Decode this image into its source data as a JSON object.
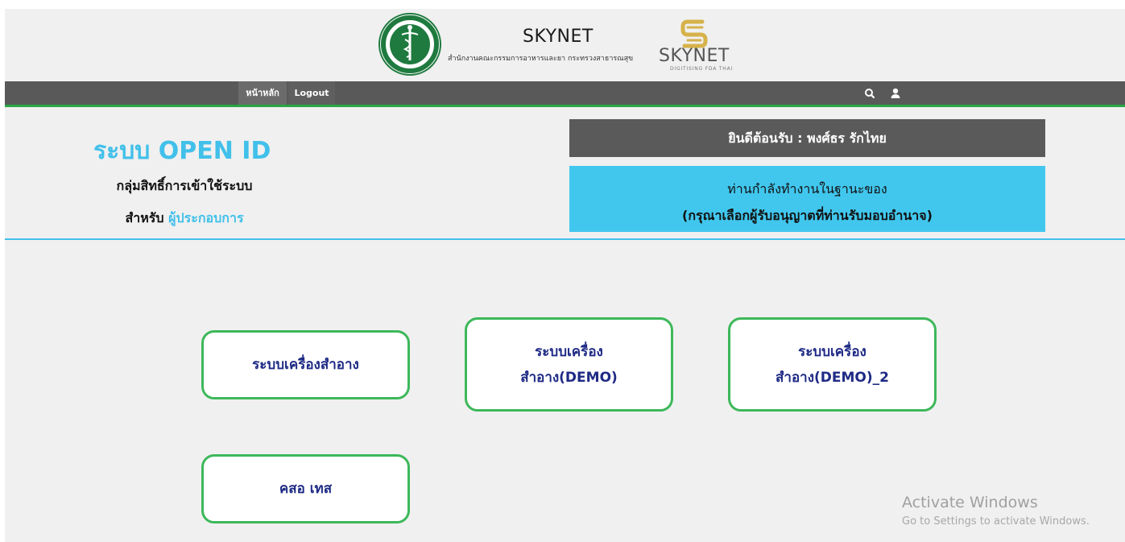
{
  "header": {
    "title": "SKYNET",
    "subtitle": "สำนักงานคณะกรรมการอาหารและยา กระทรวงสาธารณสุข",
    "brand": "SKYNET",
    "brand_tagline": "DIGITISING FDA THAI",
    "brand_color": "#d6b24a",
    "emblem_color": "#1f7a3f"
  },
  "nav": {
    "items": [
      "หน้าหลัก",
      "Logout"
    ],
    "icons": [
      "search-icon",
      "user-icon"
    ]
  },
  "intro": {
    "system_title": "ระบบ OPEN ID",
    "group_label": "กลุ่มสิทธิ์การเข้าใช้ระบบ",
    "for_prefix": "สำหรับ",
    "for_role": "ผู้ประกอบการ"
  },
  "account": {
    "welcome": "ยินดีต้อนรับ : พงศ์ธร รักไทย",
    "status_line1": "ท่านกำลังทำงานในฐานะของ",
    "status_line2": "(กรุณาเลือกผู้รับอนุญาตที่ท่านรับมอบอำนาจ)"
  },
  "systems": [
    "ระบบเครื่องสำอาง",
    "ระบบเครื่อง\nสำอาง(DEMO)",
    "ระบบเครื่อง\nสำอาง(DEMO)_2",
    "คสอ เทส"
  ],
  "watermark": {
    "title": "Activate Windows",
    "subtitle": "Go to Settings to activate Windows."
  },
  "colors": {
    "accent": "#41c0ea",
    "card_border": "#3db85a",
    "card_text": "#1e2a85",
    "nav_bg": "#595959"
  }
}
